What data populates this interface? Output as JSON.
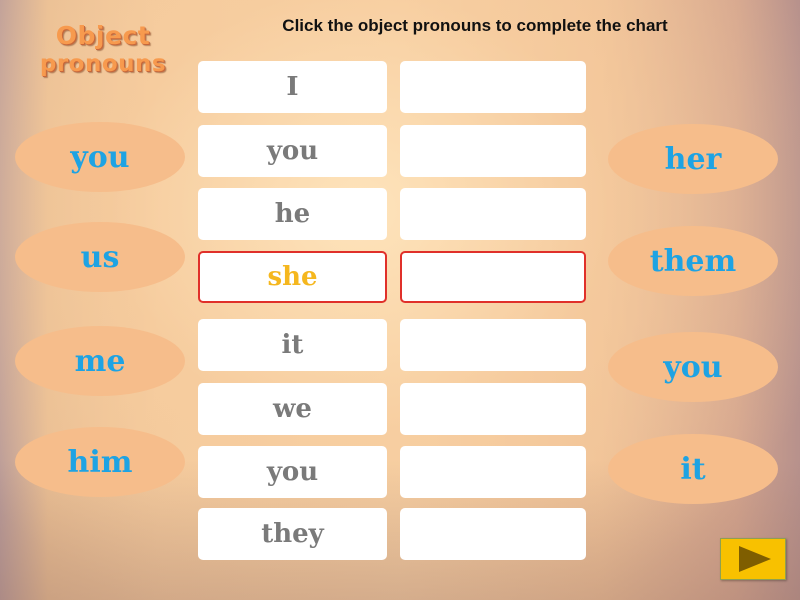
{
  "title": {
    "line1": "Object",
    "line2": "pronouns"
  },
  "instruction": "Click  the object pronouns to complete the chart",
  "chart": {
    "rows": [
      {
        "subject": "I",
        "object": ""
      },
      {
        "subject": "you",
        "object": ""
      },
      {
        "subject": "he",
        "object": ""
      },
      {
        "subject": "she",
        "object": "",
        "active": true
      },
      {
        "subject": "it",
        "object": ""
      },
      {
        "subject": "we",
        "object": ""
      },
      {
        "subject": "you",
        "object": ""
      },
      {
        "subject": "they",
        "object": ""
      }
    ]
  },
  "options_left": [
    "you",
    "us",
    "me",
    "him"
  ],
  "options_right": [
    "her",
    "them",
    "you",
    "it"
  ],
  "next_button": {
    "icon": "play-icon"
  },
  "colors": {
    "option_bg": "#f6bd8b",
    "option_text": "#1ea3e3",
    "active_border": "#e0302a",
    "active_text": "#f5b71e",
    "subject_text": "#7a7a7a",
    "title_text": "#f79a4e",
    "next_button_bg": "#f8c100"
  }
}
